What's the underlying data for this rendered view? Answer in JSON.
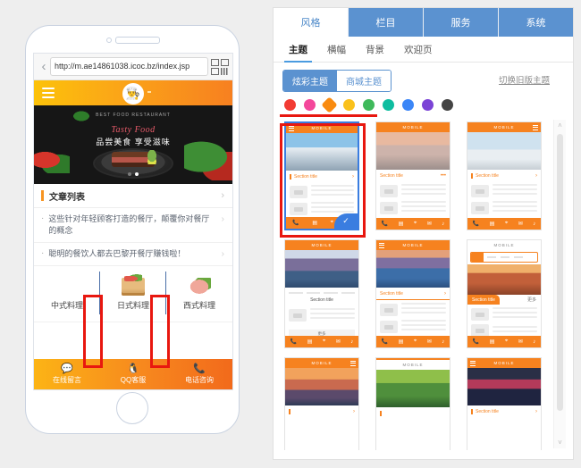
{
  "phone": {
    "browser": {
      "back_icon": "back-chevron",
      "url": "http://m.ae14861038.icoc.bz/index.jsp",
      "qr_icon": "qr-code-icon"
    },
    "site_header": {
      "menu_icon": "hamburger-menu-icon",
      "logo_glyph": "👨‍🍳"
    },
    "banner": {
      "arc_text": "BEST FOOD RESTAURANT",
      "script_text": "Tasty Food",
      "title": "品尝美食 享受滋味",
      "dots": 2,
      "active_dot": 2
    },
    "article_section": {
      "title": "文章列表",
      "chevron": "chevron-right-icon",
      "items": [
        "这些针对年轻顾客打造的餐厅，颠覆你对餐厅的概念",
        "聪明的餐饮人都去巴黎开餐厅赚钱啦！"
      ]
    },
    "categories": [
      {
        "label": "中式料理",
        "img": "chinese-dish-image"
      },
      {
        "label": "日式料理",
        "img": "japanese-dish-image"
      },
      {
        "label": "西式料理",
        "img": "western-dish-image"
      }
    ],
    "bottom_bar": [
      {
        "label": "在线留言",
        "icon": "message-icon",
        "glyph": "💬"
      },
      {
        "label": "QQ客服",
        "icon": "qq-penguin-icon",
        "glyph": "🐧"
      },
      {
        "label": "电话咨询",
        "icon": "phone-icon",
        "glyph": "📞"
      }
    ]
  },
  "panel": {
    "main_tabs": [
      {
        "label": "风格",
        "active": true
      },
      {
        "label": "栏目",
        "active": false
      },
      {
        "label": "服务",
        "active": false
      },
      {
        "label": "系统",
        "active": false
      }
    ],
    "sub_tabs": [
      {
        "label": "主题",
        "active": true
      },
      {
        "label": "横幅",
        "active": false
      },
      {
        "label": "背景",
        "active": false
      },
      {
        "label": "欢迎页",
        "active": false
      }
    ],
    "theme_toolbar": {
      "segments": [
        {
          "label": "炫彩主题",
          "active": true
        },
        {
          "label": "商城主题",
          "active": false
        }
      ],
      "switch_link": "切换旧版主题"
    },
    "colors": {
      "accent_blue": "#5b92d0",
      "orange": "#f6821f",
      "annotation_red": "#e8170f",
      "swatches": [
        {
          "name": "red",
          "hex": "#f23b33",
          "selected": false
        },
        {
          "name": "pink",
          "hex": "#f4479b",
          "selected": false
        },
        {
          "name": "orange",
          "hex": "#f98b10",
          "selected": true
        },
        {
          "name": "yellow",
          "hex": "#fac11c",
          "selected": false
        },
        {
          "name": "green",
          "hex": "#3fb95b",
          "selected": false
        },
        {
          "name": "teal",
          "hex": "#0fbda0",
          "selected": false
        },
        {
          "name": "blue",
          "hex": "#3b86f7",
          "selected": false
        },
        {
          "name": "purple",
          "hex": "#7b43d6",
          "selected": false
        },
        {
          "name": "gray",
          "hex": "#444444",
          "selected": false
        }
      ]
    },
    "templates": [
      {
        "id": 1,
        "header": "MOBILE",
        "section": "Section title",
        "hero": "hero-snow",
        "selected": true,
        "check": "✓"
      },
      {
        "id": 2,
        "header": "MOBILE",
        "section": "Section title",
        "hero": "hero-beach",
        "selected": false,
        "more": "•••"
      },
      {
        "id": 3,
        "header": "MOBILE",
        "section": "Section title",
        "hero": "hero-road",
        "selected": false,
        "more": "›"
      },
      {
        "id": 4,
        "header": "MOBILE",
        "section": "Section title",
        "hero": "hero-mtn",
        "selected": false,
        "button": "更多"
      },
      {
        "id": 5,
        "header": "MOBILE",
        "section": "Section title",
        "hero": "hero-yos",
        "selected": false,
        "more": "›"
      },
      {
        "id": 6,
        "header": "MOBILE",
        "section": "Section title",
        "hero": "hero-canyon",
        "selected": false,
        "tab_off": "更多"
      },
      {
        "id": 7,
        "header": "MOBILE",
        "section": "",
        "hero": "hero-sunset",
        "selected": false
      },
      {
        "id": 8,
        "header": "MOBILE",
        "section": "",
        "hero": "hero-leaf",
        "selected": false
      },
      {
        "id": 9,
        "header": "MOBILE",
        "section": "Section title",
        "hero": "hero-city",
        "selected": false
      }
    ],
    "scrollbar": {
      "up": "˄",
      "down": "˅"
    }
  }
}
